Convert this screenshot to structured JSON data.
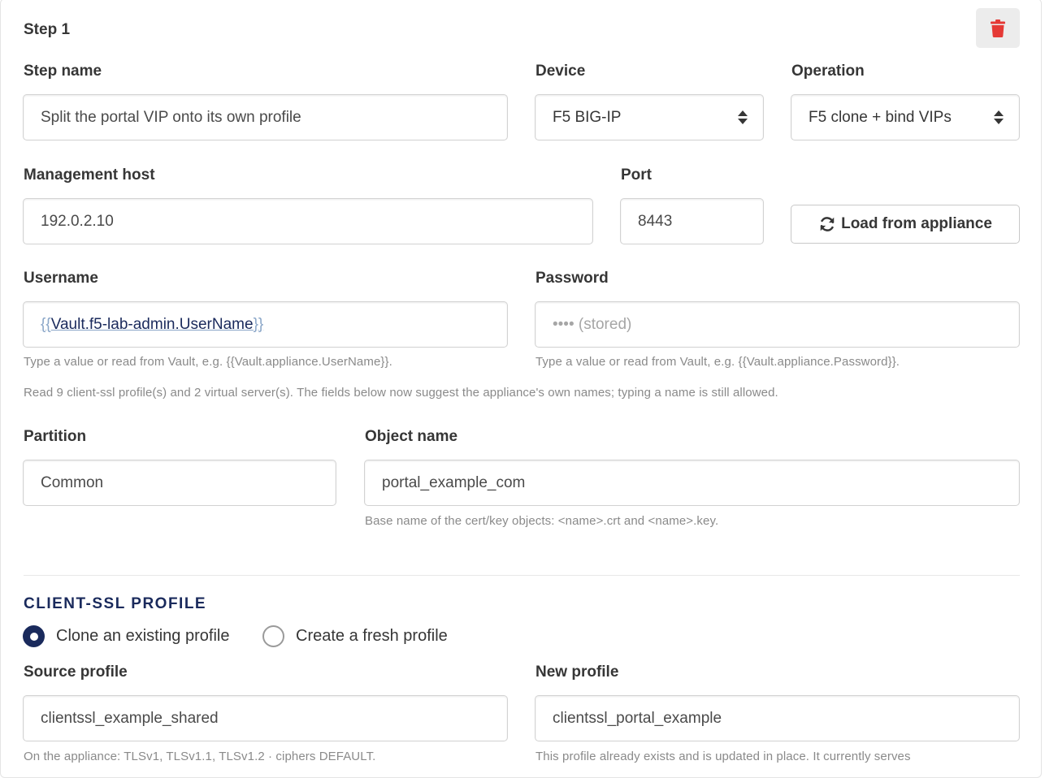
{
  "step": {
    "title": "Step 1",
    "delete_icon": "trash-icon",
    "delete_color": "#e53935"
  },
  "labels": {
    "step_name": "Step name",
    "device": "Device",
    "operation": "Operation",
    "management_host": "Management host",
    "port": "Port",
    "username": "Username",
    "password": "Password",
    "partition": "Partition",
    "object_name": "Object name",
    "source_profile": "Source profile",
    "new_profile": "New profile"
  },
  "values": {
    "step_name": "Split the portal VIP onto its own profile",
    "device": "F5 BIG-IP",
    "operation": "F5 clone + bind VIPs",
    "management_host": "192.0.2.10",
    "port": "8443",
    "username_open": "{{",
    "username_var": "Vault.f5-lab-admin.UserName",
    "username_close": "}}",
    "password_placeholder": "•••• (stored)",
    "partition": "Common",
    "object_name": "portal_example_com",
    "source_profile": "clientssl_example_shared",
    "new_profile": "clientssl_portal_example"
  },
  "buttons": {
    "load": "Load from appliance",
    "load_icon": "refresh-icon"
  },
  "help": {
    "username": "Type a value or read from Vault, e.g. {{Vault.appliance.UserName}}.",
    "password": "Type a value or read from Vault, e.g. {{Vault.appliance.Password}}.",
    "read_status": "Read 9 client-ssl profile(s) and 2 virtual server(s). The fields below now suggest the appliance's own names; typing a name is still allowed.",
    "object_name": "Base name of the cert/key objects: <name>.crt and <name>.key.",
    "source_profile": "On the appliance: TLSv1, TLSv1.1, TLSv1.2 · ciphers DEFAULT.",
    "new_profile": "This profile already exists and is updated in place. It currently serves"
  },
  "section": {
    "title": "CLIENT-SSL PROFILE",
    "radio_clone": "Clone an existing profile",
    "radio_fresh": "Create a fresh profile",
    "selected": "clone"
  },
  "colors": {
    "accent": "#1a2a5c",
    "danger": "#e53935"
  }
}
